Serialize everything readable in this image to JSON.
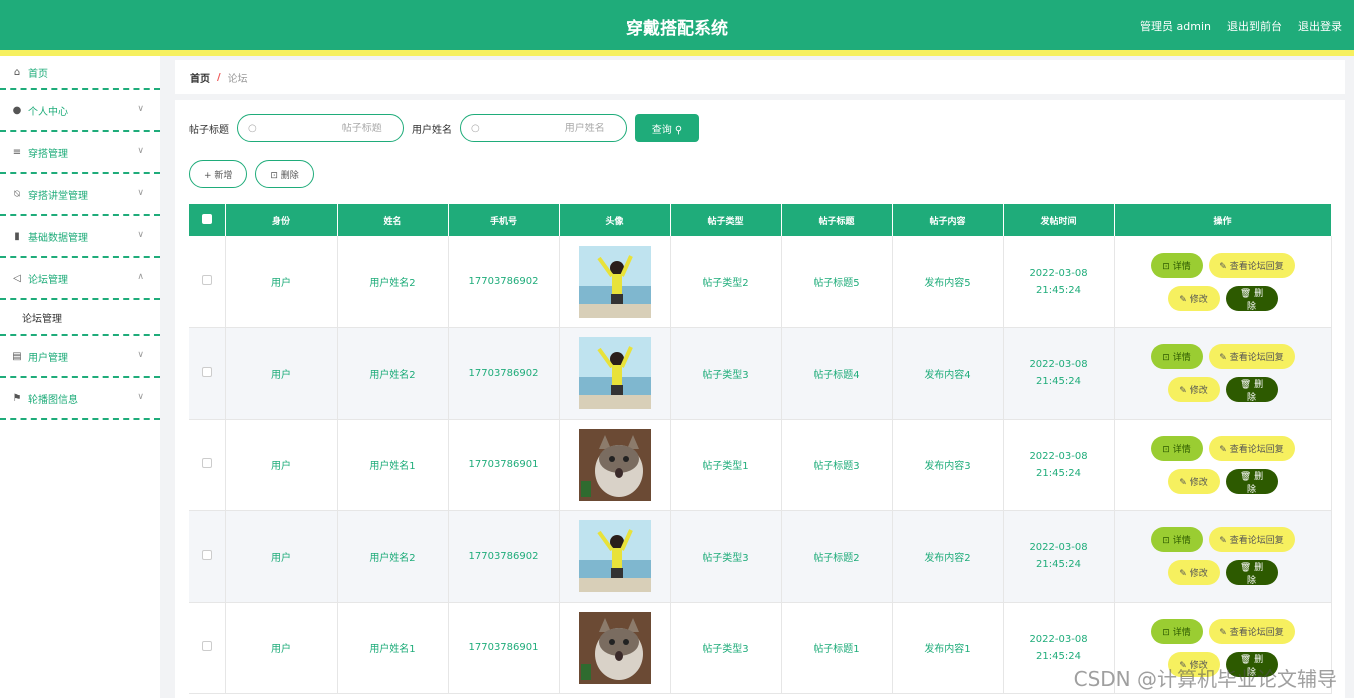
{
  "header": {
    "title": "穿戴搭配系统",
    "admin": "管理员 admin",
    "to_front": "退出到前台",
    "logout": "退出登录"
  },
  "sidebar": {
    "items": [
      {
        "label": "首页",
        "icon": "home-icon"
      },
      {
        "label": "个人中心",
        "icon": "user-icon"
      },
      {
        "label": "穿搭管理",
        "icon": "list-icon"
      },
      {
        "label": "穿搭讲堂管理",
        "icon": "bell-off-icon"
      },
      {
        "label": "基础数据管理",
        "icon": "chart-icon"
      },
      {
        "label": "论坛管理",
        "icon": "send-icon"
      },
      {
        "label": "用户管理",
        "icon": "printer-icon"
      },
      {
        "label": "轮播图信息",
        "icon": "flag-icon"
      }
    ],
    "submenu_forum": "论坛管理"
  },
  "breadcrumb": {
    "home": "首页",
    "sep": "/",
    "current": "论坛"
  },
  "search": {
    "title_label": "帖子标题",
    "title_placeholder": "帖子标题",
    "user_label": "用户姓名",
    "user_placeholder": "用户姓名",
    "query_button": "查询 ⚲"
  },
  "actions": {
    "add": "+ 新增",
    "delete": "⊡ 删除"
  },
  "table": {
    "headers": [
      "身份",
      "姓名",
      "手机号",
      "头像",
      "帖子类型",
      "帖子标题",
      "帖子内容",
      "发帖时间",
      "操作"
    ],
    "rows": [
      {
        "role": "用户",
        "name": "用户姓名2",
        "phone": "17703786902",
        "avatar": "girl-photo",
        "type": "帖子类型2",
        "title": "帖子标题5",
        "content": "发布内容5",
        "time": "2022-03-08 21:45:24"
      },
      {
        "role": "用户",
        "name": "用户姓名2",
        "phone": "17703786902",
        "avatar": "girl-photo",
        "type": "帖子类型3",
        "title": "帖子标题4",
        "content": "发布内容4",
        "time": "2022-03-08 21:45:24"
      },
      {
        "role": "用户",
        "name": "用户姓名1",
        "phone": "17703786901",
        "avatar": "cat-photo",
        "type": "帖子类型1",
        "title": "帖子标题3",
        "content": "发布内容3",
        "time": "2022-03-08 21:45:24"
      },
      {
        "role": "用户",
        "name": "用户姓名2",
        "phone": "17703786902",
        "avatar": "girl-photo",
        "type": "帖子类型3",
        "title": "帖子标题2",
        "content": "发布内容2",
        "time": "2022-03-08 21:45:24"
      },
      {
        "role": "用户",
        "name": "用户姓名1",
        "phone": "17703786901",
        "avatar": "cat-photo",
        "type": "帖子类型3",
        "title": "帖子标题1",
        "content": "发布内容1",
        "time": "2022-03-08 21:45:24"
      }
    ],
    "op_labels": {
      "detail": "⊡ 详情",
      "reply": "✎ 查看论坛回复",
      "edit": "✎ 修改",
      "delete": "🗑 删除"
    }
  },
  "watermark": "CSDN @计算机毕业论文辅导",
  "colors": {
    "primary": "#1fac7a",
    "accent_yellow": "#f6f05f",
    "detail_green": "#9acd32",
    "delete_dark": "#2d5a00"
  }
}
